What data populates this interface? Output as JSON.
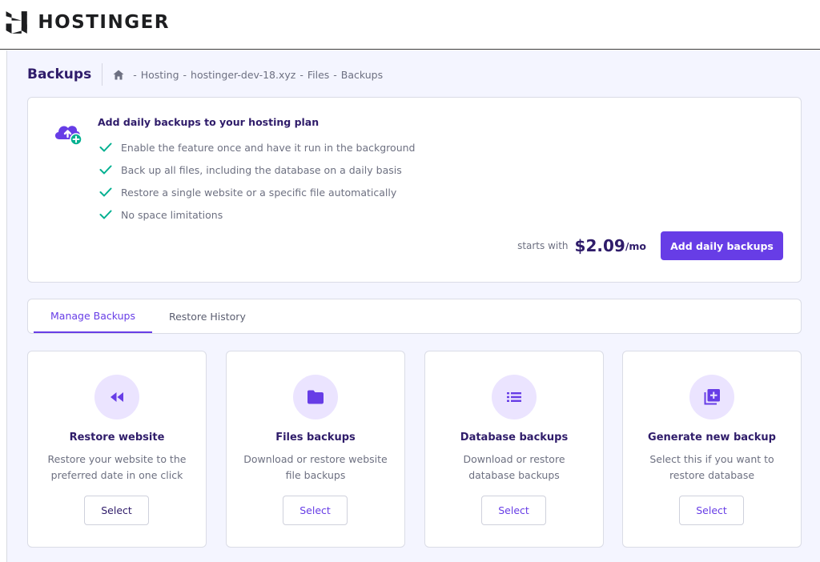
{
  "brand": {
    "name": "HOSTINGER"
  },
  "header": {
    "title": "Backups",
    "breadcrumb": [
      "Hosting",
      "hostinger-dev-18.xyz",
      "Files",
      "Backups"
    ],
    "breadcrumb_separator": "-"
  },
  "promo": {
    "title": "Add daily backups to your hosting plan",
    "features": [
      "Enable the feature once and have it run in the background",
      "Back up all files, including the database on a daily basis",
      "Restore a single website or a specific file automatically",
      "No space limitations"
    ],
    "starts_with": "starts with",
    "price": "$2.09",
    "per": "/mo",
    "button": "Add daily backups",
    "icon": "cloud-upload-icon"
  },
  "tabs": [
    {
      "label": "Manage Backups",
      "active": true
    },
    {
      "label": "Restore History",
      "active": false
    }
  ],
  "cards": [
    {
      "title": "Restore website",
      "description": "Restore your website to the preferred date in one click",
      "button": "Select",
      "icon": "rewind-icon"
    },
    {
      "title": "Files backups",
      "description": "Download or restore website file backups",
      "button": "Select",
      "icon": "folder-icon"
    },
    {
      "title": "Database backups",
      "description": "Download or restore database backups",
      "button": "Select",
      "icon": "list-icon"
    },
    {
      "title": "Generate new backup",
      "description": "Select this if you want to restore database",
      "button": "Select",
      "icon": "add-library-icon"
    }
  ],
  "colors": {
    "accent": "#673de6",
    "text_primary": "#2f1c6a",
    "text_secondary": "#6d7081",
    "check": "#00b090",
    "background": "#f4f5ff"
  }
}
